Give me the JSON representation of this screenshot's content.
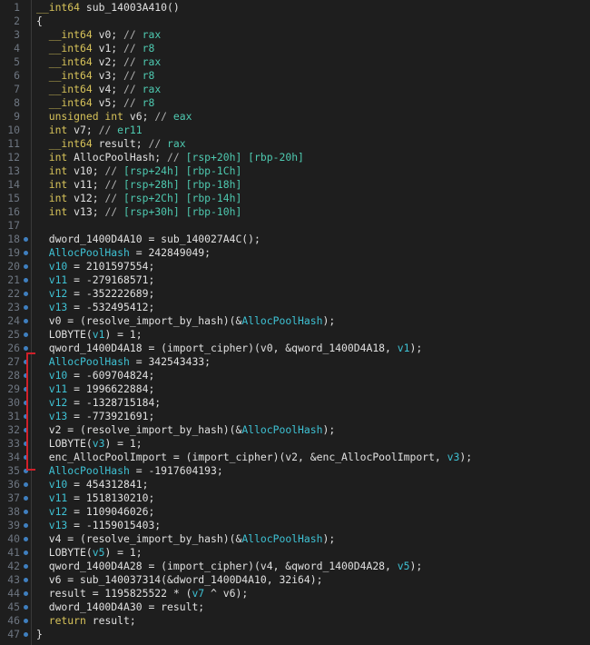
{
  "lines": [
    {
      "num": "1",
      "dot": false,
      "tokens": [
        [
          "kw",
          "__int64"
        ],
        [
          "fn",
          " sub_14003A410()"
        ]
      ]
    },
    {
      "num": "2",
      "dot": false,
      "tokens": [
        [
          "punct",
          "{"
        ]
      ]
    },
    {
      "num": "3",
      "dot": false,
      "tokens": [
        [
          "kw",
          "  __int64"
        ],
        [
          "id",
          " v0; "
        ],
        [
          "cmt",
          "// "
        ],
        [
          "reg",
          "rax"
        ]
      ]
    },
    {
      "num": "4",
      "dot": false,
      "tokens": [
        [
          "kw",
          "  __int64"
        ],
        [
          "id",
          " v1; "
        ],
        [
          "cmt",
          "// "
        ],
        [
          "reg",
          "r8"
        ]
      ]
    },
    {
      "num": "5",
      "dot": false,
      "tokens": [
        [
          "kw",
          "  __int64"
        ],
        [
          "id",
          " v2; "
        ],
        [
          "cmt",
          "// "
        ],
        [
          "reg",
          "rax"
        ]
      ]
    },
    {
      "num": "6",
      "dot": false,
      "tokens": [
        [
          "kw",
          "  __int64"
        ],
        [
          "id",
          " v3; "
        ],
        [
          "cmt",
          "// "
        ],
        [
          "reg",
          "r8"
        ]
      ]
    },
    {
      "num": "7",
      "dot": false,
      "tokens": [
        [
          "kw",
          "  __int64"
        ],
        [
          "id",
          " v4; "
        ],
        [
          "cmt",
          "// "
        ],
        [
          "reg",
          "rax"
        ]
      ]
    },
    {
      "num": "8",
      "dot": false,
      "tokens": [
        [
          "kw",
          "  __int64"
        ],
        [
          "id",
          " v5; "
        ],
        [
          "cmt",
          "// "
        ],
        [
          "reg",
          "r8"
        ]
      ]
    },
    {
      "num": "9",
      "dot": false,
      "tokens": [
        [
          "kw",
          "  unsigned int"
        ],
        [
          "id",
          " v6; "
        ],
        [
          "cmt",
          "// "
        ],
        [
          "reg",
          "eax"
        ]
      ]
    },
    {
      "num": "10",
      "dot": false,
      "tokens": [
        [
          "kw",
          "  int"
        ],
        [
          "id",
          " v7; "
        ],
        [
          "cmt",
          "// "
        ],
        [
          "reg",
          "er11"
        ]
      ]
    },
    {
      "num": "11",
      "dot": false,
      "tokens": [
        [
          "kw",
          "  __int64"
        ],
        [
          "id",
          " result; "
        ],
        [
          "cmt",
          "// "
        ],
        [
          "reg",
          "rax"
        ]
      ]
    },
    {
      "num": "12",
      "dot": false,
      "tokens": [
        [
          "kw",
          "  int"
        ],
        [
          "id",
          " AllocPoolHash; "
        ],
        [
          "cmt",
          "// "
        ],
        [
          "reg",
          "[rsp+20h] [rbp-20h]"
        ]
      ]
    },
    {
      "num": "13",
      "dot": false,
      "tokens": [
        [
          "kw",
          "  int"
        ],
        [
          "id",
          " v10; "
        ],
        [
          "cmt",
          "// "
        ],
        [
          "reg",
          "[rsp+24h] [rbp-1Ch]"
        ]
      ]
    },
    {
      "num": "14",
      "dot": false,
      "tokens": [
        [
          "kw",
          "  int"
        ],
        [
          "id",
          " v11; "
        ],
        [
          "cmt",
          "// "
        ],
        [
          "reg",
          "[rsp+28h] [rbp-18h]"
        ]
      ]
    },
    {
      "num": "15",
      "dot": false,
      "tokens": [
        [
          "kw",
          "  int"
        ],
        [
          "id",
          " v12; "
        ],
        [
          "cmt",
          "// "
        ],
        [
          "reg",
          "[rsp+2Ch] [rbp-14h]"
        ]
      ]
    },
    {
      "num": "16",
      "dot": false,
      "tokens": [
        [
          "kw",
          "  int"
        ],
        [
          "id",
          " v13; "
        ],
        [
          "cmt",
          "// "
        ],
        [
          "reg",
          "[rsp+30h] [rbp-10h]"
        ]
      ]
    },
    {
      "num": "17",
      "dot": false,
      "tokens": [
        [
          "id",
          ""
        ]
      ]
    },
    {
      "num": "18",
      "dot": true,
      "tokens": [
        [
          "id",
          "  dword_1400D4A10 = sub_140027A4C();"
        ]
      ]
    },
    {
      "num": "19",
      "dot": true,
      "tokens": [
        [
          "var",
          "  AllocPoolHash"
        ],
        [
          "id",
          " = 242849049;"
        ]
      ]
    },
    {
      "num": "20",
      "dot": true,
      "tokens": [
        [
          "var",
          "  v10"
        ],
        [
          "id",
          " = 2101597554;"
        ]
      ]
    },
    {
      "num": "21",
      "dot": true,
      "tokens": [
        [
          "var",
          "  v11"
        ],
        [
          "id",
          " = -279168571;"
        ]
      ]
    },
    {
      "num": "22",
      "dot": true,
      "tokens": [
        [
          "var",
          "  v12"
        ],
        [
          "id",
          " = -352222689;"
        ]
      ]
    },
    {
      "num": "23",
      "dot": true,
      "tokens": [
        [
          "var",
          "  v13"
        ],
        [
          "id",
          " = -532495412;"
        ]
      ]
    },
    {
      "num": "24",
      "dot": true,
      "tokens": [
        [
          "id",
          "  v0 = (resolve_import_by_hash)(&"
        ],
        [
          "var",
          "AllocPoolHash"
        ],
        [
          "id",
          ");"
        ]
      ]
    },
    {
      "num": "25",
      "dot": true,
      "tokens": [
        [
          "id",
          "  LOBYTE("
        ],
        [
          "var",
          "v1"
        ],
        [
          "id",
          ") = 1;"
        ]
      ]
    },
    {
      "num": "26",
      "dot": true,
      "tokens": [
        [
          "id",
          "  qword_1400D4A18 = (import_cipher)(v0, &qword_1400D4A18, "
        ],
        [
          "var",
          "v1"
        ],
        [
          "id",
          ");"
        ]
      ]
    },
    {
      "num": "27",
      "dot": true,
      "tokens": [
        [
          "var",
          "  AllocPoolHash"
        ],
        [
          "id",
          " = 342543433;"
        ]
      ]
    },
    {
      "num": "28",
      "dot": true,
      "tokens": [
        [
          "var",
          "  v10"
        ],
        [
          "id",
          " = -609704824;"
        ]
      ]
    },
    {
      "num": "29",
      "dot": true,
      "tokens": [
        [
          "var",
          "  v11"
        ],
        [
          "id",
          " = 1996622884;"
        ]
      ]
    },
    {
      "num": "30",
      "dot": true,
      "tokens": [
        [
          "var",
          "  v12"
        ],
        [
          "id",
          " = -1328715184;"
        ]
      ]
    },
    {
      "num": "31",
      "dot": true,
      "tokens": [
        [
          "var",
          "  v13"
        ],
        [
          "id",
          " = -773921691;"
        ]
      ]
    },
    {
      "num": "32",
      "dot": true,
      "tokens": [
        [
          "id",
          "  v2 = (resolve_import_by_hash)(&"
        ],
        [
          "var",
          "AllocPoolHash"
        ],
        [
          "id",
          ");"
        ]
      ]
    },
    {
      "num": "33",
      "dot": true,
      "tokens": [
        [
          "id",
          "  LOBYTE("
        ],
        [
          "var",
          "v3"
        ],
        [
          "id",
          ") = 1;"
        ]
      ]
    },
    {
      "num": "34",
      "dot": true,
      "tokens": [
        [
          "id",
          "  enc_AllocPoolImport = (import_cipher)(v2, &enc_AllocPoolImport, "
        ],
        [
          "var",
          "v3"
        ],
        [
          "id",
          ");"
        ]
      ]
    },
    {
      "num": "35",
      "dot": true,
      "tokens": [
        [
          "var",
          "  AllocPoolHash"
        ],
        [
          "id",
          " = -1917604193;"
        ]
      ]
    },
    {
      "num": "36",
      "dot": true,
      "tokens": [
        [
          "var",
          "  v10"
        ],
        [
          "id",
          " = 454312841;"
        ]
      ]
    },
    {
      "num": "37",
      "dot": true,
      "tokens": [
        [
          "var",
          "  v11"
        ],
        [
          "id",
          " = 1518130210;"
        ]
      ]
    },
    {
      "num": "38",
      "dot": true,
      "tokens": [
        [
          "var",
          "  v12"
        ],
        [
          "id",
          " = 1109046026;"
        ]
      ]
    },
    {
      "num": "39",
      "dot": true,
      "tokens": [
        [
          "var",
          "  v13"
        ],
        [
          "id",
          " = -1159015403;"
        ]
      ]
    },
    {
      "num": "40",
      "dot": true,
      "tokens": [
        [
          "id",
          "  v4 = (resolve_import_by_hash)(&"
        ],
        [
          "var",
          "AllocPoolHash"
        ],
        [
          "id",
          ");"
        ]
      ]
    },
    {
      "num": "41",
      "dot": true,
      "tokens": [
        [
          "id",
          "  LOBYTE("
        ],
        [
          "var",
          "v5"
        ],
        [
          "id",
          ") = 1;"
        ]
      ]
    },
    {
      "num": "42",
      "dot": true,
      "tokens": [
        [
          "id",
          "  qword_1400D4A28 = (import_cipher)(v4, &qword_1400D4A28, "
        ],
        [
          "var",
          "v5"
        ],
        [
          "id",
          ");"
        ]
      ]
    },
    {
      "num": "43",
      "dot": true,
      "tokens": [
        [
          "id",
          "  v6 = sub_140037314(&dword_1400D4A10, 32i64);"
        ]
      ]
    },
    {
      "num": "44",
      "dot": true,
      "tokens": [
        [
          "id",
          "  result = 1195825522 * ("
        ],
        [
          "var",
          "v7"
        ],
        [
          "id",
          " ^ v6);"
        ]
      ]
    },
    {
      "num": "45",
      "dot": true,
      "tokens": [
        [
          "id",
          "  dword_1400D4A30 = result;"
        ]
      ]
    },
    {
      "num": "46",
      "dot": true,
      "tokens": [
        [
          "kw",
          "  return"
        ],
        [
          "id",
          " result;"
        ]
      ]
    },
    {
      "num": "47",
      "dot": true,
      "tokens": [
        [
          "punct",
          "}"
        ]
      ]
    }
  ],
  "colors": {
    "background": "#1e1e1e",
    "keyword": "#d7c35a",
    "variable": "#3ec1d3",
    "register": "#4ec9b0",
    "text": "#e0e0e0",
    "line_number": "#6e7681",
    "breakpoint_dot": "#3f7fbf",
    "highlight_bracket": "#d0202a"
  }
}
